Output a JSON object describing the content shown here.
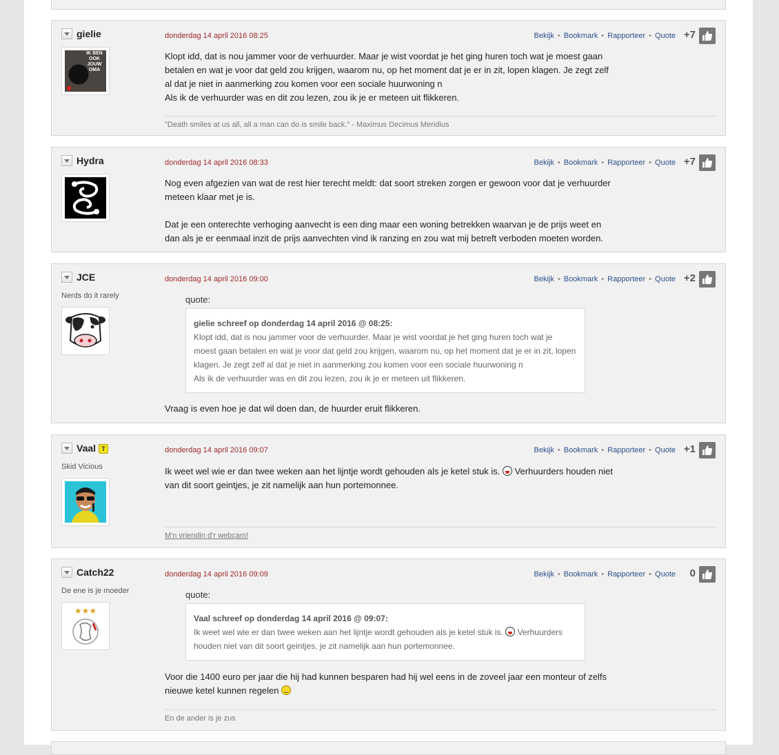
{
  "actions": {
    "view": "Bekijk",
    "bookmark": "Bookmark",
    "report": "Rapporteer",
    "quote": "Quote",
    "separator": "•"
  },
  "quote_label": "quote:",
  "posts": [
    {
      "username": "gielie",
      "date": "donderdag 14 april 2016 08:25",
      "score": "+7",
      "body": [
        "Klopt idd, dat is nou jammer voor de verhuurder. Maar je wist voordat je het ging huren toch wat je moest gaan betalen en wat je voor dat geld zou krijgen, waarom nu, op het moment dat je er in zit, lopen klagen. Je zegt zelf al dat je niet in aanmerking zou komen voor een sociale huurwoning n",
        "Als ik de verhuurder was en dit zou lezen, zou ik je er meteen uit flikkeren."
      ],
      "signature": "\"Death smiles at us all, all a man can do is smile back.\" - Maximus Decimus Meridius",
      "avatar_text": "IK BEN OOK JOUW OMA"
    },
    {
      "username": "Hydra",
      "date": "donderdag 14 april 2016 08:33",
      "score": "+7",
      "body": [
        "Nog even afgezien van wat de rest hier terecht meldt: dat soort streken zorgen er gewoon voor dat je verhuurder meteen klaar met je is.",
        "Dat je een onterechte verhoging aanvecht is een ding maar een woning betrekken waarvan je de prijs weet en dan als je er eenmaal inzit de prijs aanvechten vind ik ranzing en zou wat mij betreft verboden moeten worden."
      ]
    },
    {
      "username": "JCE",
      "subtitle": "Nerds do it rarely",
      "date": "donderdag 14 april 2016 09:00",
      "score": "+2",
      "quote": {
        "header": "gielie schreef op donderdag 14 april 2016 @ 08:25:",
        "lines": [
          "Klopt idd, dat is nou jammer voor de verhuurder. Maar je wist voordat je het ging huren toch wat je moest gaan betalen en wat je voor dat geld zou krijgen, waarom nu, op het moment dat je er in zit, lopen klagen. Je zegt zelf al dat je niet in aanmerking zou komen voor een sociale huurwoning n",
          "Als ik de verhuurder was en dit zou lezen, zou ik je er meteen uit flikkeren."
        ]
      },
      "body": [
        "Vraag is even hoe je dat wil doen dan, de huurder eruit flikkeren."
      ]
    },
    {
      "username": "Vaal",
      "subtitle": "Skid Vicious",
      "badge": "T",
      "date": "donderdag 14 april 2016 09:07",
      "score": "+1",
      "body_a": "Ik weet wel wie er dan twee weken aan het lijntje wordt gehouden als je ketel stuk is.",
      "body_b": "Verhuurders houden niet van dit soort geintjes, je zit namelijk aan hun portemonnee.",
      "signature": "M'n vriendin d'r webcam!"
    },
    {
      "username": "Catch22",
      "subtitle": "De ene is je moeder",
      "date": "donderdag 14 april 2016 09:09",
      "score": "0",
      "quote": {
        "header": "Vaal schreef op donderdag 14 april 2016 @ 09:07:",
        "line_a": "Ik weet wel wie er dan twee weken aan het lijntje wordt gehouden als je ketel stuk is.",
        "line_b": "Verhuurders houden niet van dit soort geintjes, je zit namelijk aan hun portemonnee."
      },
      "body": "Voor die 1400 euro per jaar die hij had kunnen besparen had hij wel eens in de zoveel jaar een monteur of zelfs nieuwe ketel kunnen regelen",
      "signature": "En de ander is je zus"
    }
  ]
}
